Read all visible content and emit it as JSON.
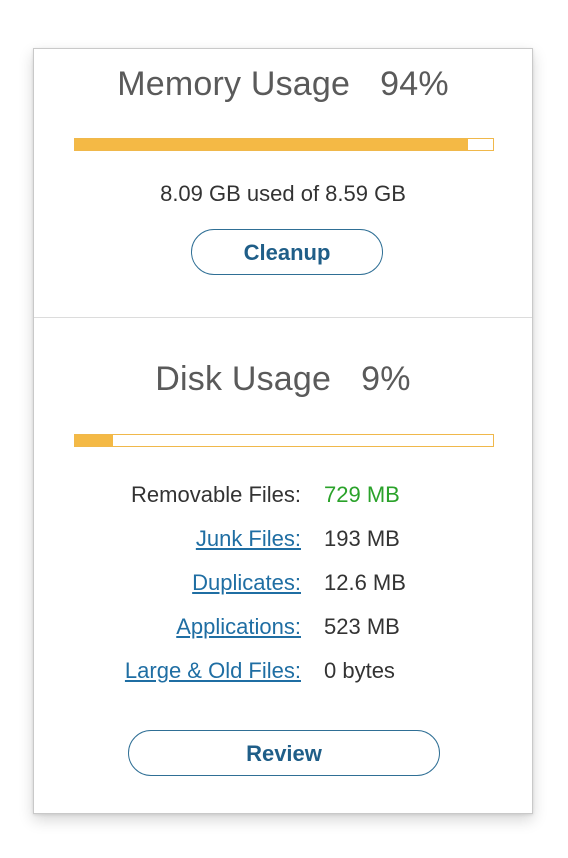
{
  "memory": {
    "title": "Memory Usage",
    "percent_label": "94%",
    "percent_value": 94,
    "usage_text": "8.09 GB used of 8.59 GB",
    "cleanup_label": "Cleanup"
  },
  "disk": {
    "title": "Disk Usage",
    "percent_label": "9%",
    "percent_value": 9,
    "rows": [
      {
        "label": "Removable Files:",
        "value": "729 MB"
      },
      {
        "label": "Junk Files:",
        "value": "193 MB"
      },
      {
        "label": "Duplicates:",
        "value": "12.6 MB"
      },
      {
        "label": "Applications:",
        "value": "523 MB"
      },
      {
        "label": "Large & Old Files:",
        "value": "0 bytes"
      }
    ],
    "review_label": "Review"
  },
  "colors": {
    "bar_fill": "#f4b945",
    "bar_border": "#f0b84b",
    "link": "#1f6ea3",
    "removable_value": "#2aa22a",
    "button_text": "#1f5e88"
  }
}
